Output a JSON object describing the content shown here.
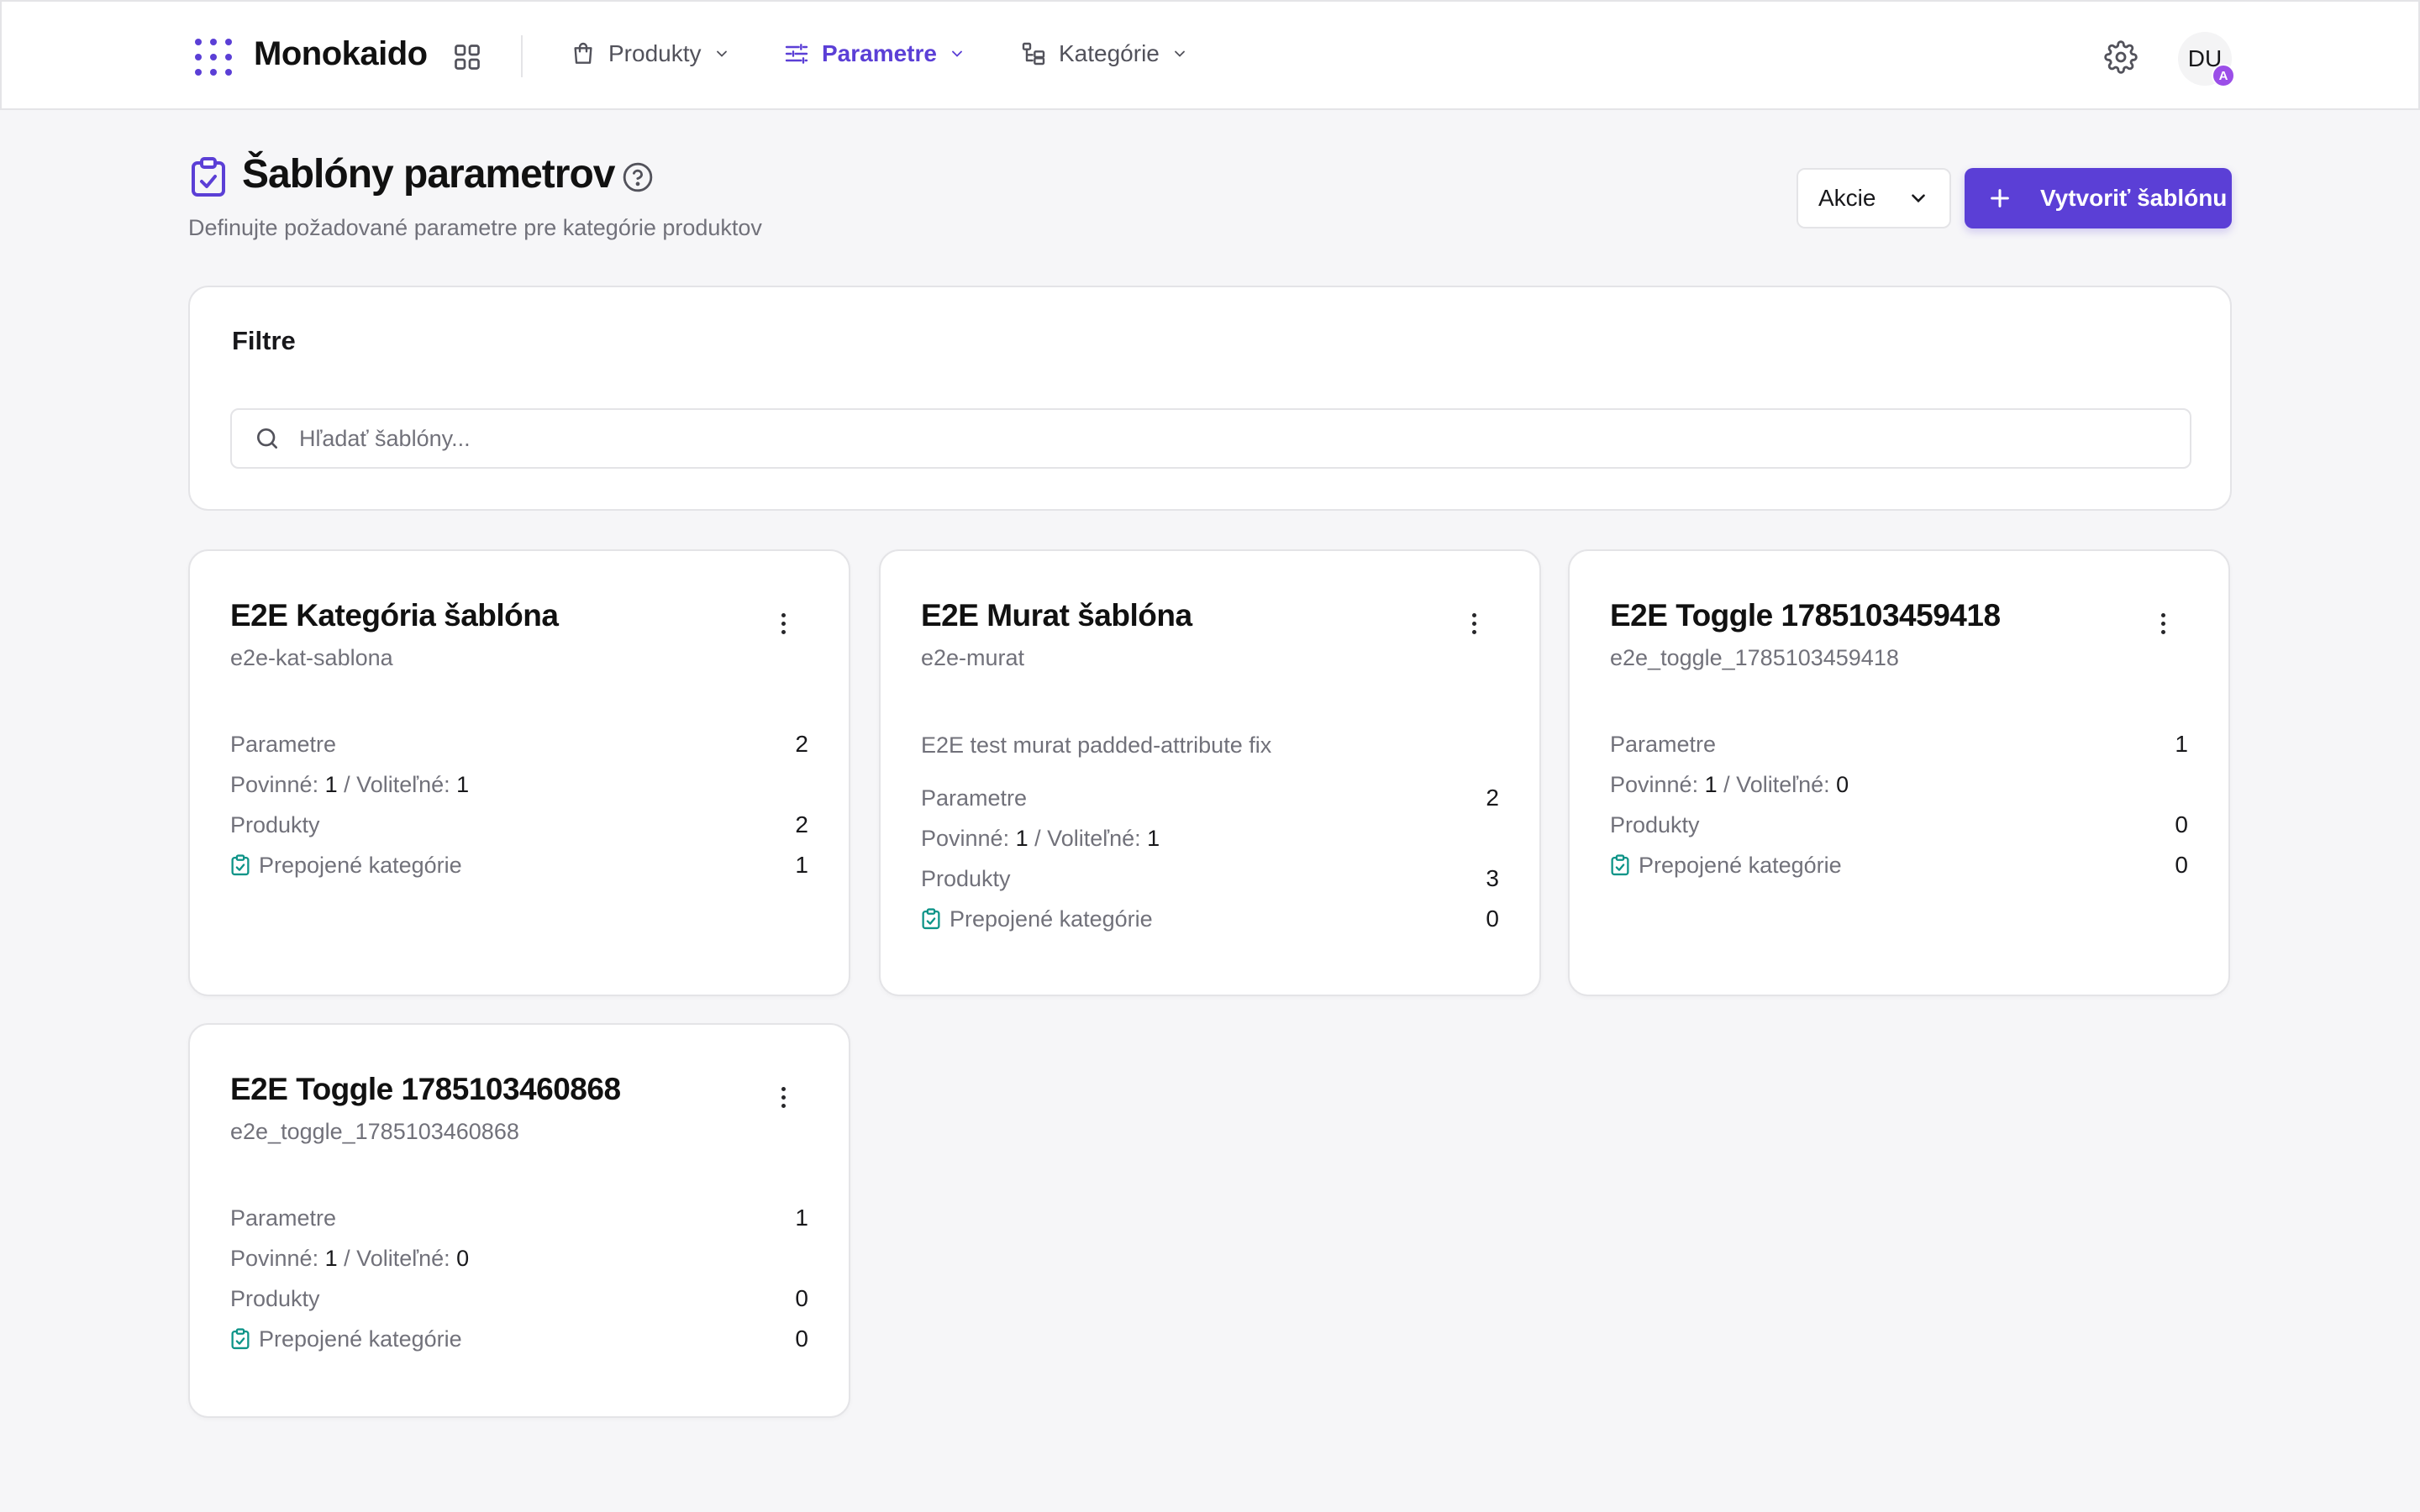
{
  "app": {
    "brand": "Monokaido"
  },
  "nav": {
    "items": [
      {
        "label": "Produkty",
        "icon": "shopping-bag-icon"
      },
      {
        "label": "Parametre",
        "icon": "sliders-icon",
        "active": true
      },
      {
        "label": "Kategórie",
        "icon": "category-tree-icon"
      }
    ],
    "user": {
      "initials": "DU",
      "badge": "A"
    }
  },
  "header": {
    "title": "Šablóny parametrov",
    "subtitle": "Definujte požadované parametre pre kategórie produktov",
    "actions_label": "Akcie",
    "create_label": "Vytvoriť šablónu"
  },
  "filters": {
    "title": "Filtre",
    "search_placeholder": "Hľadať šablóny...",
    "search_value": ""
  },
  "labels": {
    "parameters": "Parametre",
    "required": "Povinné:",
    "optional": "Voliteľné:",
    "separator": "/",
    "products": "Produkty",
    "linked_categories": "Prepojené kategórie"
  },
  "templates": [
    {
      "name": "E2E Kategória šablóna",
      "slug": "e2e-kat-sablona",
      "description": "",
      "parameters": "2",
      "required": "1",
      "optional": "1",
      "products": "2",
      "linked_categories": "1"
    },
    {
      "name": "E2E Murat šablóna",
      "slug": "e2e-murat",
      "description": "E2E test murat padded-attribute fix",
      "parameters": "2",
      "required": "1",
      "optional": "1",
      "products": "3",
      "linked_categories": "0"
    },
    {
      "name": "E2E Toggle 1785103459418",
      "slug": "e2e_toggle_1785103459418",
      "description": "",
      "parameters": "1",
      "required": "1",
      "optional": "0",
      "products": "0",
      "linked_categories": "0"
    },
    {
      "name": "E2E Toggle 1785103460868",
      "slug": "e2e_toggle_1785103460868",
      "description": "",
      "parameters": "1",
      "required": "1",
      "optional": "0",
      "products": "0",
      "linked_categories": "0"
    }
  ],
  "colors": {
    "accent": "#5b3fd6",
    "linked_icon": "#0d9488",
    "badge": "#9b4ee8"
  }
}
